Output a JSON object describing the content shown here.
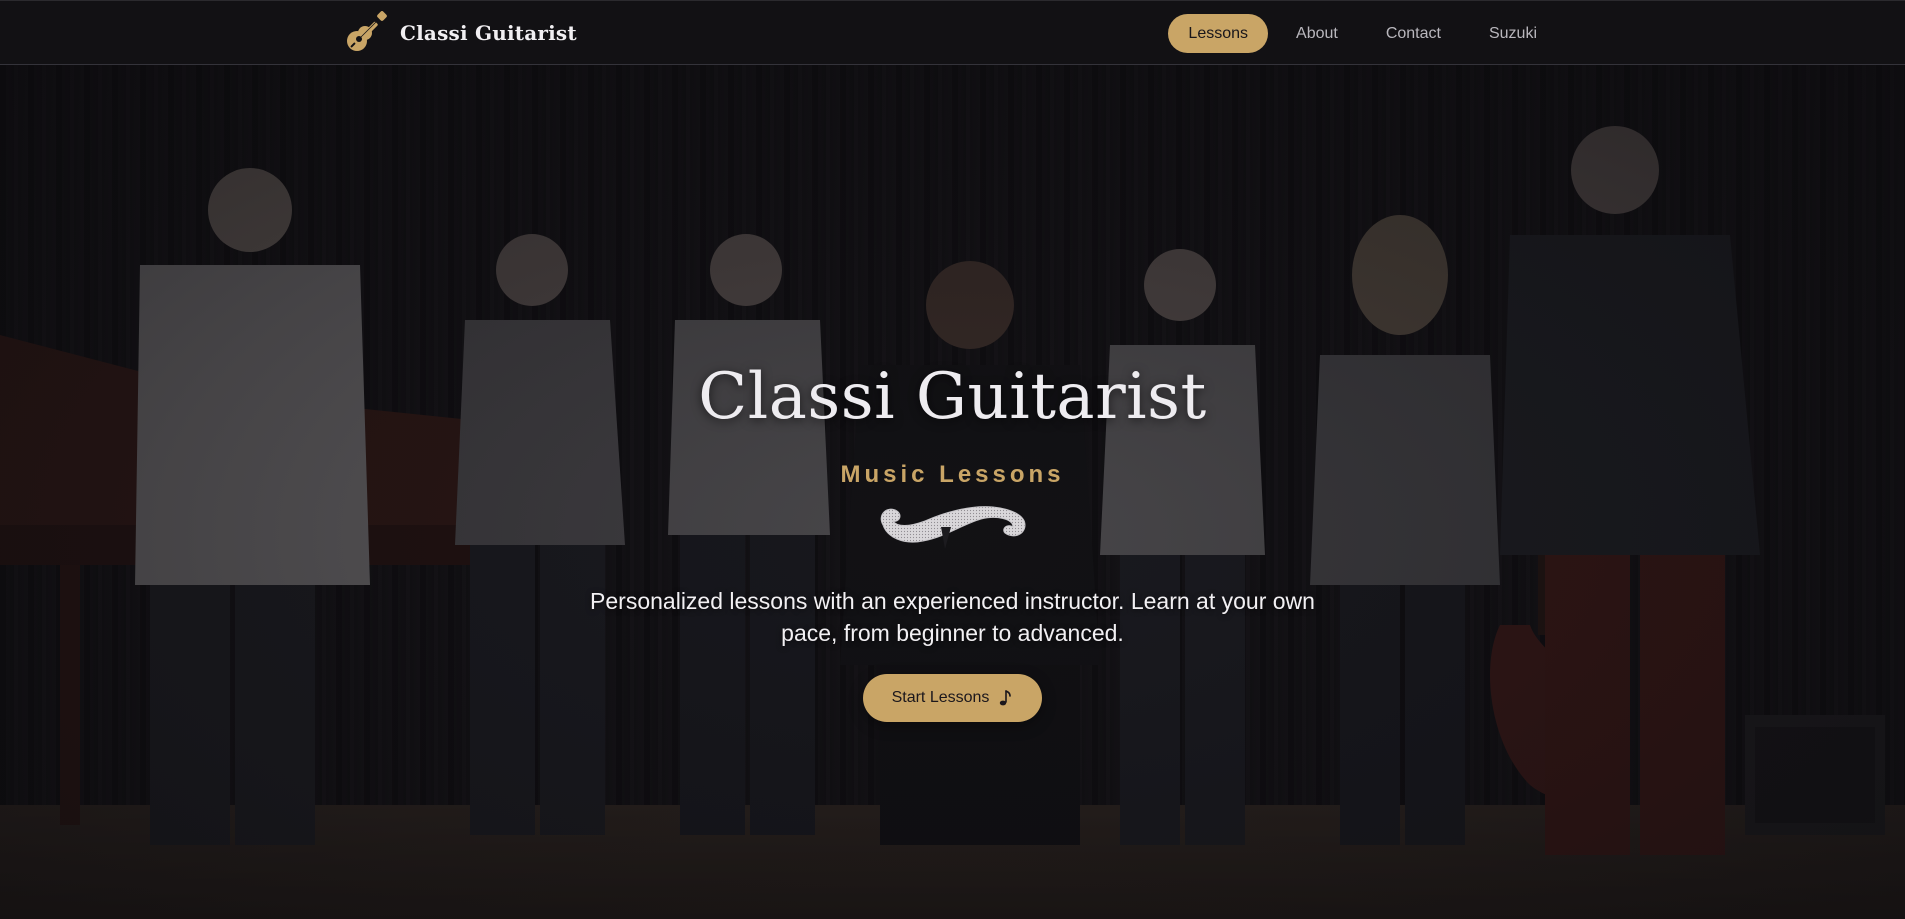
{
  "nav": {
    "brand_name": "Classi Guitarist",
    "brand_icon": "guitar-icon",
    "links": [
      {
        "label": "Lessons",
        "active": true
      },
      {
        "label": "About",
        "active": false
      },
      {
        "label": "Contact",
        "active": false
      },
      {
        "label": "Suzuki",
        "active": false
      }
    ]
  },
  "hero": {
    "title": "Classi Guitarist",
    "subtitle": "Music Lessons",
    "ornament_icon": "f-hole-scroll-icon",
    "description": "Personalized lessons with an experienced instructor. Learn at your own pace, from beginner to advanced.",
    "cta_label": "Start Lessons",
    "cta_icon": "music-note-icon",
    "background_image": "students-on-stage-photo"
  },
  "colors": {
    "accent_gold": "#c9a566",
    "nav_background": "#121114",
    "text_light": "#eeecf0"
  }
}
